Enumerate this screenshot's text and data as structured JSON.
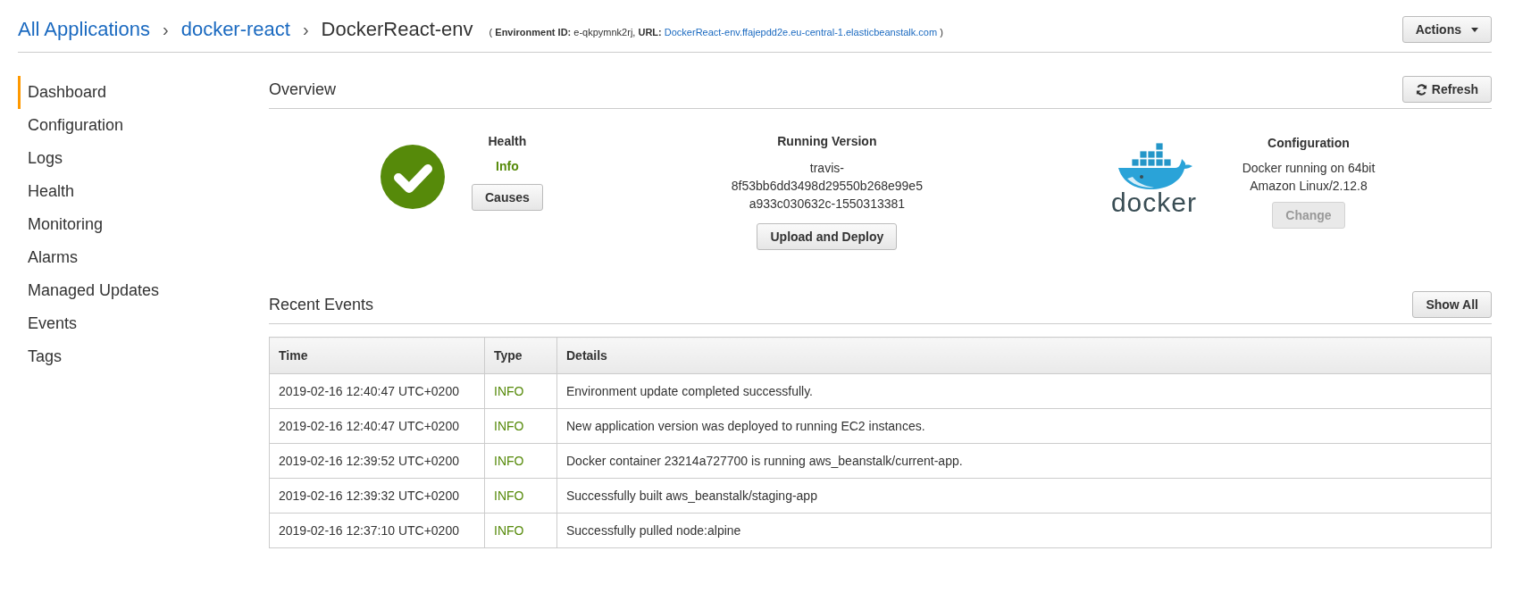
{
  "breadcrumb": {
    "items": [
      {
        "label": "All Applications",
        "kind": "link"
      },
      {
        "label": "docker-react",
        "kind": "link"
      },
      {
        "label": "DockerReact-env",
        "kind": "current"
      }
    ],
    "separator": "›"
  },
  "environment_info": {
    "prefix": "( **Environment ID:** e-qkpymnk2rj, **URL:**",
    "url": "DockerReact-env.ffajepdd2e.eu-central-1.elasticbeanstalk.com",
    "suffix": ")"
  },
  "actions_button": {
    "label": "Actions"
  },
  "sidebar": {
    "items": [
      {
        "label": "Dashboard",
        "selected": true
      },
      {
        "label": "Configuration",
        "selected": false
      },
      {
        "label": "Logs",
        "selected": false
      },
      {
        "label": "Health",
        "selected": false
      },
      {
        "label": "Monitoring",
        "selected": false
      },
      {
        "label": "Alarms",
        "selected": false
      },
      {
        "label": "Managed Updates",
        "selected": false
      },
      {
        "label": "Events",
        "selected": false
      },
      {
        "label": "Tags",
        "selected": false
      }
    ]
  },
  "overview": {
    "title": "Overview",
    "refresh_button": "Refresh",
    "health": {
      "title": "Health",
      "status": "Info",
      "button": {
        "label": "Causes",
        "disabled": false
      }
    },
    "running_version": {
      "title": "Running Version",
      "lines": [
        "travis-",
        "8f53bb6dd3498d29550b268e99e5",
        "a933c030632c-1550313381"
      ],
      "button": {
        "label": "Upload and Deploy",
        "disabled": false
      }
    },
    "configuration": {
      "logo_text": "docker",
      "title": "Configuration",
      "description": "Docker running on 64bit Amazon Linux/2.12.8",
      "button": {
        "label": "Change",
        "disabled": true
      }
    }
  },
  "recent_events": {
    "title": "Recent Events",
    "show_all_button": "Show All",
    "table": {
      "columns": [
        "Time",
        "Type",
        "Details"
      ],
      "rows": [
        {
          "time": "2019-02-16 12:40:47 UTC+0200",
          "type": "INFO",
          "details": "Environment update completed successfully."
        },
        {
          "time": "2019-02-16 12:40:47 UTC+0200",
          "type": "INFO",
          "details": "New application version was deployed to running EC2 instances."
        },
        {
          "time": "2019-02-16 12:39:52 UTC+0200",
          "type": "INFO",
          "details": "Docker container 23214a727700 is running aws_beanstalk/current-app."
        },
        {
          "time": "2019-02-16 12:39:32 UTC+0200",
          "type": "INFO",
          "details": "Successfully built aws_beanstalk/staging-app"
        },
        {
          "time": "2019-02-16 12:37:10 UTC+0200",
          "type": "INFO",
          "details": "Successfully pulled node:alpine"
        }
      ]
    }
  }
}
